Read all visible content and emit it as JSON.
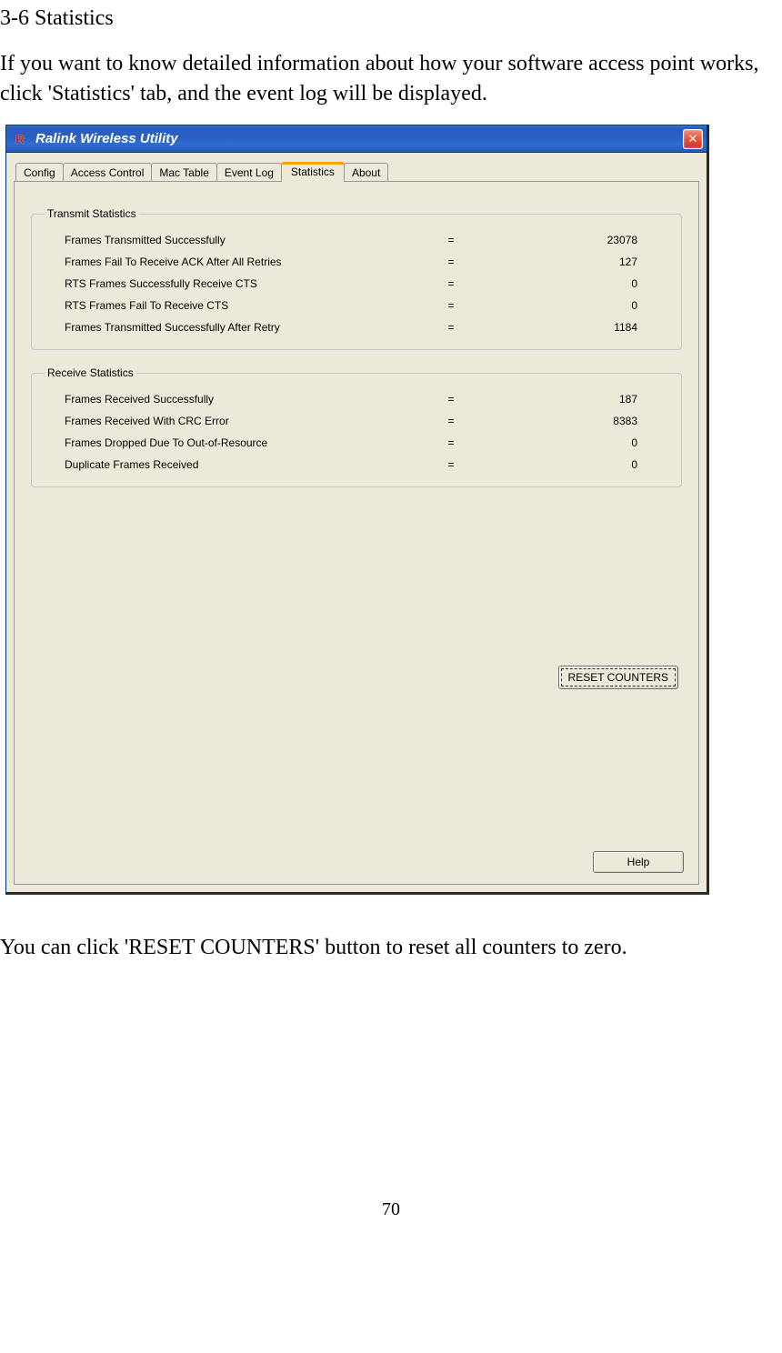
{
  "doc": {
    "heading": "3-6 Statistics",
    "intro": "If you want to know detailed information about how your software access point works, click 'Statistics' tab, and the event log will be displayed.",
    "outro": "You can click 'RESET COUNTERS' button to reset all counters to zero.",
    "page_number": "70"
  },
  "window": {
    "title": "Ralink Wireless Utility",
    "tabs": [
      "Config",
      "Access Control",
      "Mac Table",
      "Event Log",
      "Statistics",
      "About"
    ],
    "active_tab": "Statistics",
    "transmit": {
      "legend": "Transmit Statistics",
      "rows": [
        {
          "label": "Frames Transmitted Successfully",
          "value": "23078"
        },
        {
          "label": "Frames Fail To Receive ACK After All Retries",
          "value": "127"
        },
        {
          "label": "RTS Frames Successfully Receive CTS",
          "value": "0"
        },
        {
          "label": "RTS Frames Fail To Receive CTS",
          "value": "0"
        },
        {
          "label": "Frames Transmitted Successfully After Retry",
          "value": "1184"
        }
      ]
    },
    "receive": {
      "legend": "Receive Statistics",
      "rows": [
        {
          "label": "Frames Received Successfully",
          "value": "187"
        },
        {
          "label": "Frames Received With CRC Error",
          "value": "8383"
        },
        {
          "label": "Frames Dropped Due To Out-of-Resource",
          "value": "0"
        },
        {
          "label": "Duplicate Frames Received",
          "value": "0"
        }
      ]
    },
    "reset_label": "RESET COUNTERS",
    "help_label": "Help",
    "eq": "="
  }
}
